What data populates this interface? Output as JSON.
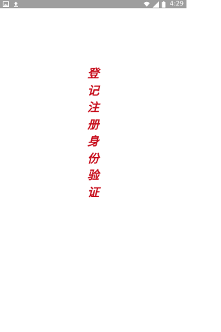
{
  "status_bar": {
    "time": "4:29",
    "left_icons": [
      "image-notification-icon",
      "upload-notification-icon"
    ],
    "right_icons": [
      "wifi-icon",
      "signal-icon",
      "battery-icon"
    ],
    "background_color": "#9e9e9e"
  },
  "title": {
    "text": "登记注册身份验证",
    "chars": [
      "登",
      "记",
      "注",
      "册",
      "身",
      "份",
      "验",
      "证"
    ],
    "color": "#c8101e"
  }
}
